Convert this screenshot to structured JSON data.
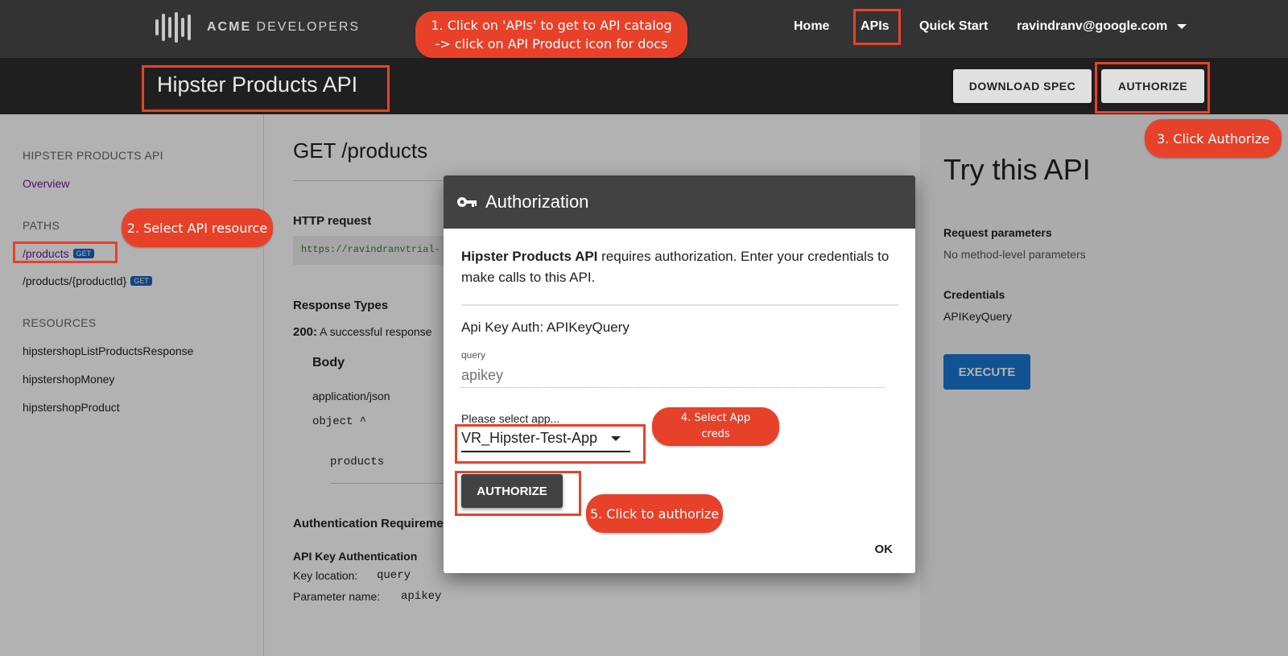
{
  "brand": {
    "strong": "ACME",
    "rest": " DEVELOPERS"
  },
  "nav": {
    "home": "Home",
    "apis": "APIs",
    "quickstart": "Quick Start",
    "user": "ravindranv@google.com"
  },
  "header": {
    "title": "Hipster Products API",
    "download_spec": "DOWNLOAD SPEC",
    "authorize": "AUTHORIZE"
  },
  "sidebar": {
    "api_heading": "HIPSTER PRODUCTS API",
    "overview": "Overview",
    "paths_heading": "PATHS",
    "paths": [
      {
        "label": "/products",
        "badge": "GET"
      },
      {
        "label": "/products/{productId}",
        "badge": "GET"
      }
    ],
    "resources_heading": "RESOURCES",
    "resources": [
      "hipstershopListProductsResponse",
      "hipstershopMoney",
      "hipstershopProduct"
    ]
  },
  "main": {
    "title": "GET /products",
    "http_request_label": "HTTP request",
    "http_url": "https://ravindranvtrial-",
    "response_types_label": "Response Types",
    "response_code": "200:",
    "response_desc": "A successful response",
    "body_label": "Body",
    "content_type": "application/json",
    "object_label": "object ^",
    "field_products": "products",
    "auth_req_label": "Authentication Requireme",
    "api_key_auth_label": "API Key Authentication",
    "key_location_label": "Key location:",
    "key_location_value": "query",
    "param_name_label": "Parameter name:",
    "param_name_value": "apikey"
  },
  "try_api": {
    "title": "Try this API",
    "request_params_label": "Request parameters",
    "request_params_value": "No method-level parameters",
    "credentials_label": "Credentials",
    "credentials_value": "APIKeyQuery",
    "execute": "EXECUTE"
  },
  "dialog": {
    "title": "Authorization",
    "api_name": "Hipster Products API",
    "desc_rest": " requires authorization. Enter your credentials to make calls to this API.",
    "auth_type": "Api Key Auth: APIKeyQuery",
    "query_label": "query",
    "query_placeholder": "apikey",
    "select_label": "Please select app...",
    "selected_app": "VR_Hipster-Test-App",
    "authorize": "AUTHORIZE",
    "ok": "OK"
  },
  "annotations": {
    "step1_line1": "1. Click on 'APIs' to get to API catalog",
    "step1_line2": "-> click on API Product icon for docs",
    "step2": "2. Select API resource",
    "step3": "3. Click Authorize",
    "step4_line1": "4. Select App",
    "step4_line2": "creds",
    "step5": "5. Click to authorize",
    "color": "#e8412a"
  }
}
